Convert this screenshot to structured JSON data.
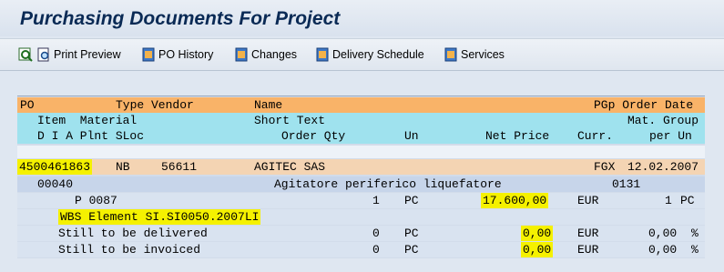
{
  "window": {
    "title": "Purchasing Documents For Project"
  },
  "toolbar": {
    "print_preview": "Print Preview",
    "po_history": "PO History",
    "changes": "Changes",
    "delivery_schedule": "Delivery Schedule",
    "services": "Services"
  },
  "headers": {
    "row1": {
      "po": "PO",
      "type_vendor": "Type Vendor",
      "name": "Name",
      "pgp_order_date": "PGp Order Date"
    },
    "row2": {
      "item_material": "Item  Material",
      "short_text": "Short Text",
      "mat_group": "Mat. Group"
    },
    "row3": {
      "diapl": "D I A Plnt SLoc",
      "order_qty": "Order Qty",
      "un": "Un",
      "net_price": "Net Price",
      "curr": "Curr.",
      "per_un": "per Un"
    }
  },
  "po_row": {
    "po_number": "4500461863",
    "type": "NB",
    "vendor": "56611",
    "name": "AGITEC SAS",
    "pgp": "FGX",
    "order_date": "12.02.2007"
  },
  "item_row": {
    "item": "00040",
    "short_text": "Agitatore periferico liquefatore",
    "mat_group": "0131"
  },
  "schedule_row": {
    "prefix": "P 0087",
    "qty": "1",
    "un": "PC",
    "net_price": "17.600,00",
    "curr": "EUR",
    "per": "1",
    "per_un": "PC"
  },
  "wbs_row": {
    "text": "WBS Element SI.SI0050.2007LI"
  },
  "delivered_row": {
    "label": "Still to be delivered",
    "qty": "0",
    "un": "PC",
    "value": "0,00",
    "curr": "EUR",
    "pct": "0,00",
    "pct_sign": "%"
  },
  "invoiced_row": {
    "label": "Still to be invoiced",
    "qty": "0",
    "un": "PC",
    "value": "0,00",
    "curr": "EUR",
    "pct": "0,00",
    "pct_sign": "%"
  },
  "colors": {
    "header_orange": "#f9b368",
    "header_cyan": "#9fe2ee",
    "po_row": "#f4d4b3",
    "highlight": "#f5f100"
  }
}
